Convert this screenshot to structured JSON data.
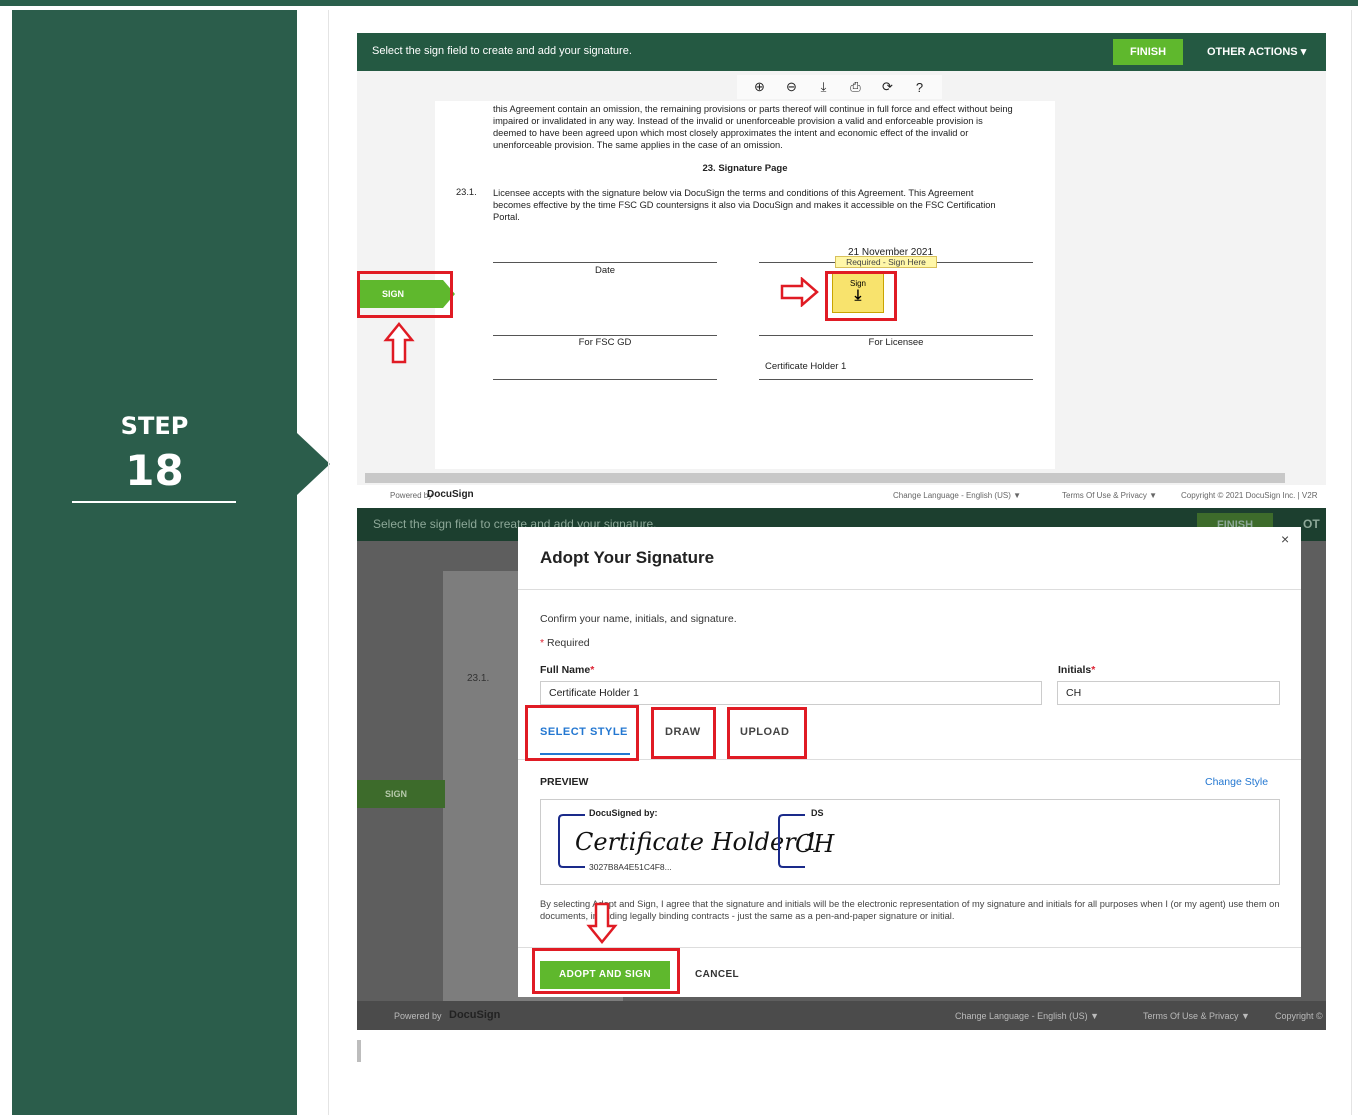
{
  "step": {
    "word": "STEP",
    "number": "18"
  },
  "shot1": {
    "header_message": "Select the sign field to create and add your signature.",
    "finish_label": "FINISH",
    "other_actions_label": "OTHER ACTIONS ▾",
    "toolbar_icons": [
      "zoom-in",
      "zoom-out",
      "download",
      "print",
      "rotate",
      "help"
    ],
    "paragraph": "this Agreement contain an omission, the remaining provisions or parts thereof will continue in full force and effect without being impaired or invalidated in any way. Instead of the invalid or unenforceable provision a valid and enforceable provision is deemed to have been agreed upon which most closely approximates the intent and economic effect of the invalid or unenforceable provision. The same applies in the case of an omission.",
    "section_title": "23. Signature Page",
    "clause_number": "23.1.",
    "clause_text": "Licensee accepts with the signature below via DocuSign the terms and conditions of this Agreement. This Agreement becomes effective by the time FSC GD countersigns it also via DocuSign and makes it accessible on the FSC Certification Portal.",
    "date_value": "21 November 2021",
    "tooltip": "Required - Sign Here",
    "sign_box_label": "Sign",
    "date_label": "Date",
    "for_fsc_label": "For FSC GD",
    "for_licensee_label": "For Licensee",
    "cert_holder_label": "Certificate Holder 1",
    "sign_tab_label": "SIGN",
    "footer_powered": "Powered by",
    "footer_brand": "DocuSign",
    "footer_language": "Change Language - English (US) ▼",
    "footer_terms": "Terms Of Use & Privacy ▼",
    "footer_copyright": "Copyright © 2021 DocuSign Inc. | V2R"
  },
  "shot2": {
    "header_message": "Select the sign field to create and add your signature.",
    "finish_label": "FINISH",
    "other_label": "OT",
    "clause_number": "23.1.",
    "sign_tab_label": "SIGN",
    "footer_powered": "Powered by",
    "footer_brand": "DocuSign",
    "footer_language": "Change Language - English (US) ▼",
    "footer_terms": "Terms Of Use & Privacy ▼",
    "footer_copyright": "Copyright ©"
  },
  "modal": {
    "title": "Adopt Your Signature",
    "close": "×",
    "confirm_text": "Confirm your name, initials, and signature.",
    "required_star": "*",
    "required_text": " Required",
    "full_name_label": "Full Name",
    "initials_label": "Initials",
    "full_name_value": "Certificate Holder 1",
    "initials_value": "CH",
    "tabs": [
      "SELECT STYLE",
      "DRAW",
      "UPLOAD"
    ],
    "preview_label": "PREVIEW",
    "change_style": "Change Style",
    "sig_header": "DocuSigned by:",
    "sig_script": "Certificate Holder 1",
    "sig_id": "3027B8A4E51C4F8...",
    "initials_header": "DS",
    "initials_script": "CH",
    "agreement": "By selecting Adopt and Sign, I agree that the signature and initials will be the electronic representation of my signature and initials for all purposes when I (or my agent) use them on documents, including legally binding contracts - just the same as a pen-and-paper signature or initial.",
    "adopt_label": "ADOPT AND SIGN",
    "cancel_label": "CANCEL"
  },
  "colors": {
    "sidebar": "#2b5d4b",
    "docusign_header": "#245942",
    "accent_green": "#5fb82d",
    "link_blue": "#2377d1",
    "highlight_red": "#e01b24"
  }
}
